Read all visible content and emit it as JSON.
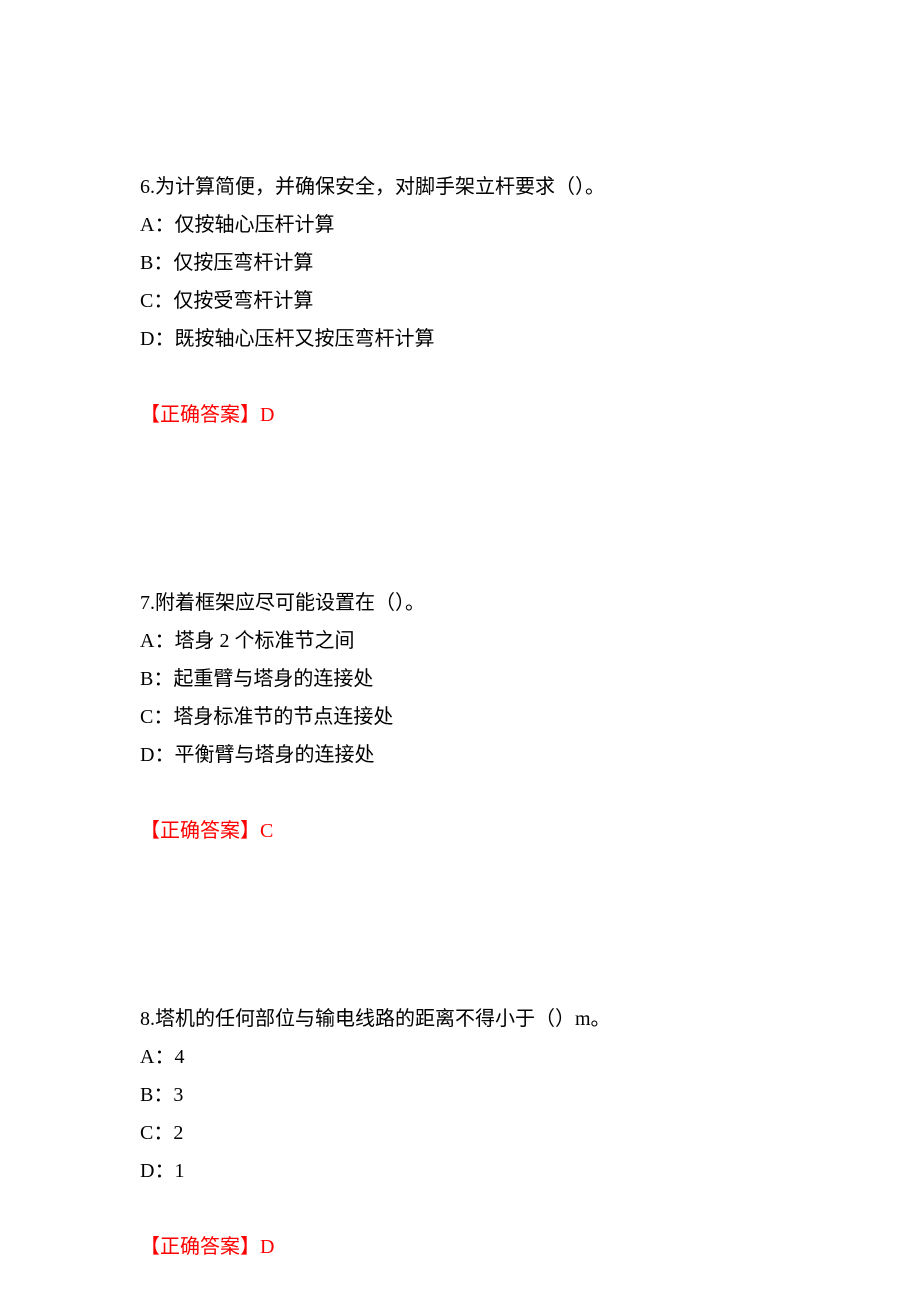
{
  "questions": [
    {
      "number": "6.",
      "text": "为计算简便，并确保安全，对脚手架立杆要求（）。",
      "options": [
        "A：仅按轴心压杆计算",
        "B：仅按压弯杆计算",
        "C：仅按受弯杆计算",
        "D：既按轴心压杆又按压弯杆计算"
      ],
      "answer_label": "【正确答案】",
      "answer_value": "D"
    },
    {
      "number": "7.",
      "text": "附着框架应尽可能设置在（）。",
      "options": [
        "A：塔身 2 个标准节之间",
        "B：起重臂与塔身的连接处",
        "C：塔身标准节的节点连接处",
        "D：平衡臂与塔身的连接处"
      ],
      "answer_label": "【正确答案】",
      "answer_value": "C"
    },
    {
      "number": "8.",
      "text": "塔机的任何部位与输电线路的距离不得小于（）m。",
      "options": [
        "A：4",
        "B：3",
        "C：2",
        "D：1"
      ],
      "answer_label": "【正确答案】",
      "answer_value": "D"
    }
  ]
}
